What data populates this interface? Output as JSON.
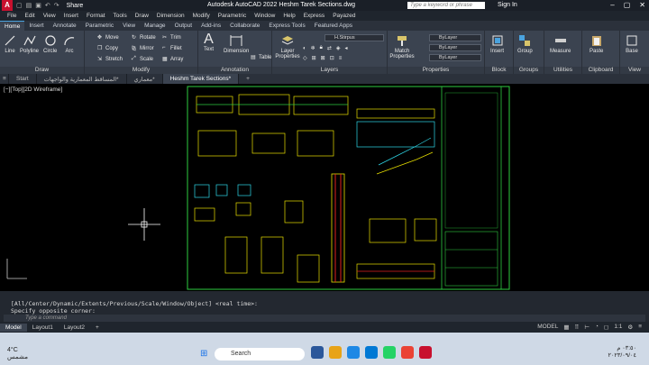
{
  "app": {
    "logo": "A",
    "title": "Autodesk AutoCAD 2022   Heshm Tarek Sections.dwg",
    "share": "Share",
    "search_placeholder": "Type a keyword or phrase",
    "signin": "Sign In"
  },
  "menu": [
    "File",
    "Edit",
    "View",
    "Insert",
    "Format",
    "Tools",
    "Draw",
    "Dimension",
    "Modify",
    "Parametric",
    "Window",
    "Help",
    "Express",
    "Payazed"
  ],
  "ribbon_tabs": [
    "Home",
    "Insert",
    "Annotate",
    "Parametric",
    "View",
    "Manage",
    "Output",
    "Add-ins",
    "Collaborate",
    "Express Tools",
    "Featured Apps"
  ],
  "ribbon": {
    "draw": {
      "title": "Draw",
      "line": "Line",
      "polyline": "Polyline",
      "circle": "Circle",
      "arc": "Arc"
    },
    "modify": {
      "title": "Modify",
      "move": "Move",
      "rotate": "Rotate",
      "trim": "Trim",
      "copy": "Copy",
      "mirror": "Mirror",
      "fillet": "Fillet",
      "stretch": "Stretch",
      "scale": "Scale",
      "array": "Array"
    },
    "annotation": {
      "title": "Annotation",
      "text": "Text",
      "dimension": "Dimension",
      "table": "Table"
    },
    "layers": {
      "title": "Layers",
      "layer_properties": "Layer Properties",
      "layer_combo": "H.Stirpus"
    },
    "properties": {
      "title": "Properties",
      "match": "Match Properties",
      "color": "ByLayer",
      "linetype": "ByLayer",
      "lineweight": "ByLayer"
    },
    "block": {
      "title": "Block",
      "insert": "Insert"
    },
    "groups": {
      "title": "Groups",
      "group": "Group"
    },
    "utilities": {
      "title": "Utilities",
      "measure": "Measure"
    },
    "clipboard": {
      "title": "Clipboard",
      "paste": "Paste"
    },
    "view": {
      "title": "View",
      "base": "Base"
    }
  },
  "doc_tabs": [
    "Start",
    "المساقط المعمارية والواجهات*",
    "معماري*",
    "Heshm Tarek Sections*"
  ],
  "viewport_label": "[−][Top][2D Wireframe]",
  "command": {
    "line1": "[All/Center/Dynamic/Extents/Previous/Scale/Window/Object] <real time>:",
    "line2": "Specify opposite corner:",
    "placeholder": "Type a command"
  },
  "layout_tabs": [
    "Model",
    "Layout1",
    "Layout2"
  ],
  "status_right": [
    "MODEL",
    "1:1"
  ],
  "taskbar": {
    "temp": "4°C",
    "weather_desc": "مشمس",
    "search": "Search",
    "time": "٠٣:٥٠ م",
    "date": "٢٠٢٣/٠٩/٠٤"
  },
  "colors": {
    "accent": "#4aa3df",
    "drawing_yellow": "#e8e000",
    "drawing_green": "#2ecc40",
    "drawing_red": "#e02020",
    "drawing_cyan": "#2fd8e8"
  }
}
